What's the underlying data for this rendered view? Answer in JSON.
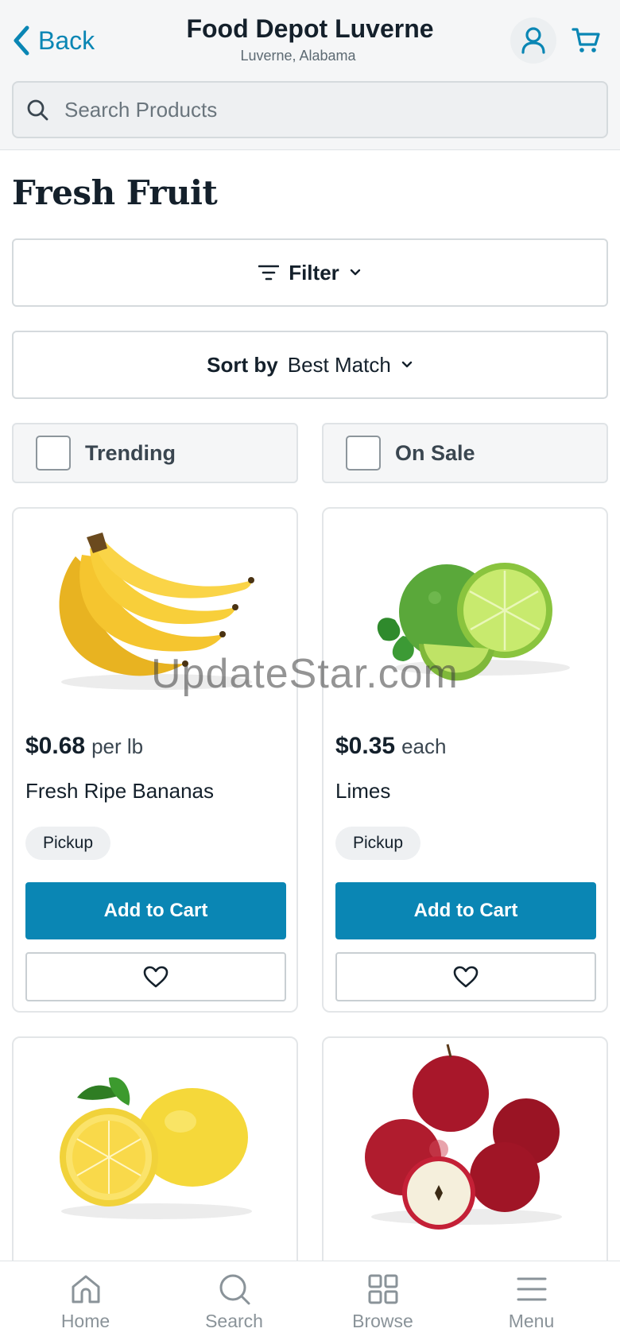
{
  "header": {
    "back_label": "Back",
    "store_name": "Food Depot Luverne",
    "store_location": "Luverne, Alabama",
    "search_placeholder": "Search Products"
  },
  "page": {
    "title": "Fresh Fruit",
    "filter_label": "Filter",
    "sort_prefix": "Sort by",
    "sort_value": "Best Match"
  },
  "toggles": {
    "trending": "Trending",
    "on_sale": "On Sale"
  },
  "products": [
    {
      "price": "$0.68",
      "unit": "per lb",
      "name": "Fresh Ripe Bananas",
      "badge": "Pickup",
      "add_label": "Add to Cart",
      "image": "bananas"
    },
    {
      "price": "$0.35",
      "unit": "each",
      "name": "Limes",
      "badge": "Pickup",
      "add_label": "Add to Cart",
      "image": "limes"
    },
    {
      "image": "lemons"
    },
    {
      "image": "red-apples"
    }
  ],
  "watermark": "UpdateStar.com",
  "nav": [
    {
      "label": "Home",
      "icon": "home-icon"
    },
    {
      "label": "Search",
      "icon": "search-icon"
    },
    {
      "label": "Browse",
      "icon": "grid-icon"
    },
    {
      "label": "Menu",
      "icon": "menu-icon"
    }
  ],
  "colors": {
    "accent": "#0a86b4",
    "text": "#14202b",
    "nav_inactive": "#8a9399"
  }
}
